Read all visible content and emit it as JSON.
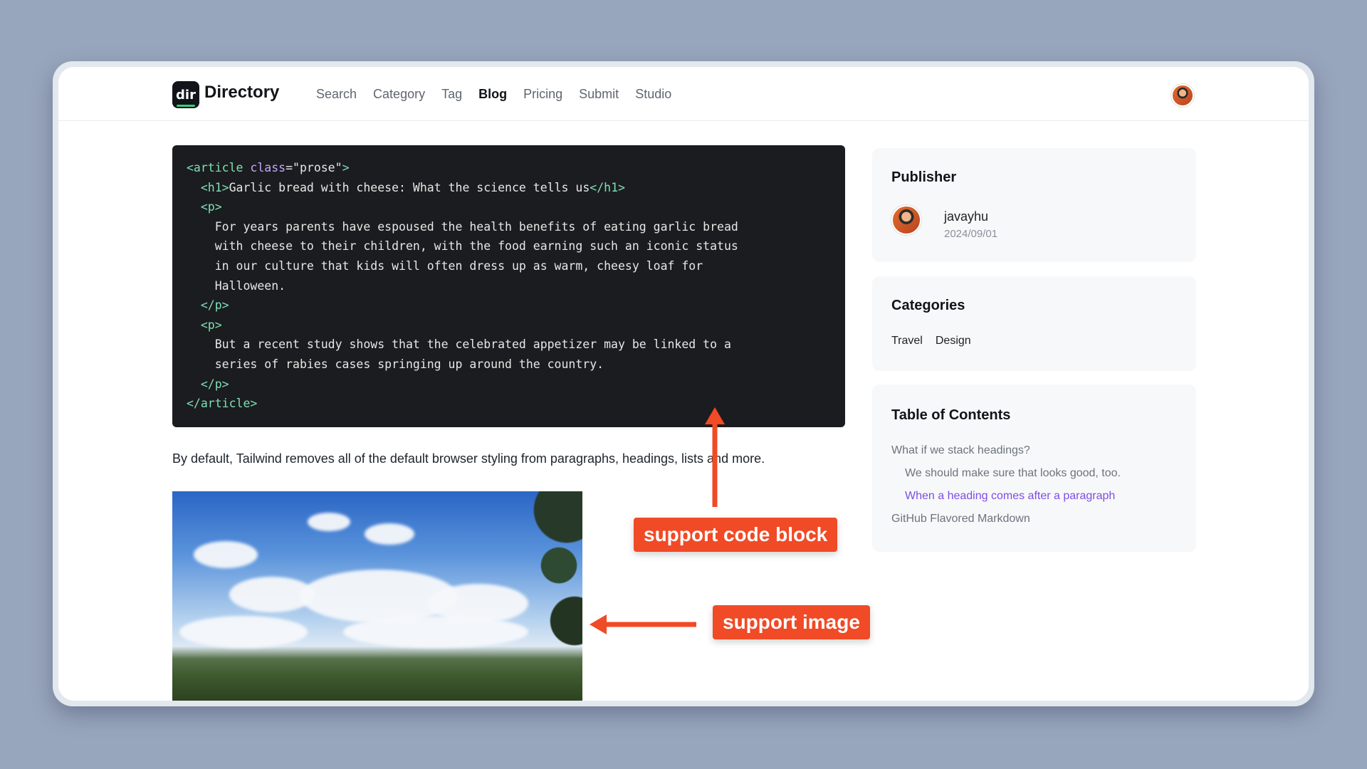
{
  "header": {
    "logo_text": "dir",
    "brand": "Directory",
    "nav": [
      {
        "label": "Search",
        "active": false
      },
      {
        "label": "Category",
        "active": false
      },
      {
        "label": "Tag",
        "active": false
      },
      {
        "label": "Blog",
        "active": true
      },
      {
        "label": "Pricing",
        "active": false
      },
      {
        "label": "Submit",
        "active": false
      },
      {
        "label": "Studio",
        "active": false
      }
    ]
  },
  "code_block": {
    "lines": [
      [
        [
          "tag",
          "<article "
        ],
        [
          "attr",
          "class"
        ],
        [
          "str",
          "=\"prose\""
        ],
        [
          "tag",
          ">"
        ]
      ],
      [
        [
          "str",
          "  "
        ],
        [
          "tag",
          "<h1>"
        ],
        [
          "str",
          "Garlic bread with cheese: What the science tells us"
        ],
        [
          "tag",
          "</h1>"
        ]
      ],
      [
        [
          "str",
          "  "
        ],
        [
          "tag",
          "<p>"
        ]
      ],
      [
        [
          "str",
          "    For years parents have espoused the health benefits of eating garlic bread"
        ]
      ],
      [
        [
          "str",
          "    with cheese to their children, with the food earning such an iconic status"
        ]
      ],
      [
        [
          "str",
          "    in our culture that kids will often dress up as warm, cheesy loaf for"
        ]
      ],
      [
        [
          "str",
          "    Halloween."
        ]
      ],
      [
        [
          "str",
          "  "
        ],
        [
          "tag",
          "</p>"
        ]
      ],
      [
        [
          "str",
          "  "
        ],
        [
          "tag",
          "<p>"
        ]
      ],
      [
        [
          "str",
          "    But a recent study shows that the celebrated appetizer may be linked to a"
        ]
      ],
      [
        [
          "str",
          "    series of rabies cases springing up around the country."
        ]
      ],
      [
        [
          "str",
          "  "
        ],
        [
          "tag",
          "</p>"
        ]
      ],
      [
        [
          "tag",
          "</article>"
        ]
      ]
    ]
  },
  "paragraph": "By default, Tailwind removes all of the default browser styling from paragraphs, headings, lists and more.",
  "publisher": {
    "title": "Publisher",
    "name": "javayhu",
    "date": "2024/09/01"
  },
  "categories": {
    "title": "Categories",
    "items": [
      "Travel",
      "Design"
    ]
  },
  "toc": {
    "title": "Table of Contents",
    "items": [
      {
        "label": "What if we stack headings?",
        "level": 1,
        "active": false
      },
      {
        "label": "We should make sure that looks good, too.",
        "level": 2,
        "active": false
      },
      {
        "label": "When a heading comes after a paragraph",
        "level": 2,
        "active": true
      },
      {
        "label": "GitHub Flavored Markdown",
        "level": 1,
        "active": false
      }
    ]
  },
  "annotations": {
    "code_label": "support code block",
    "image_label": "support image"
  },
  "colors": {
    "accent": "#f04a26",
    "toc_active": "#7c4ee4",
    "code_bg": "#1b1c1f"
  }
}
